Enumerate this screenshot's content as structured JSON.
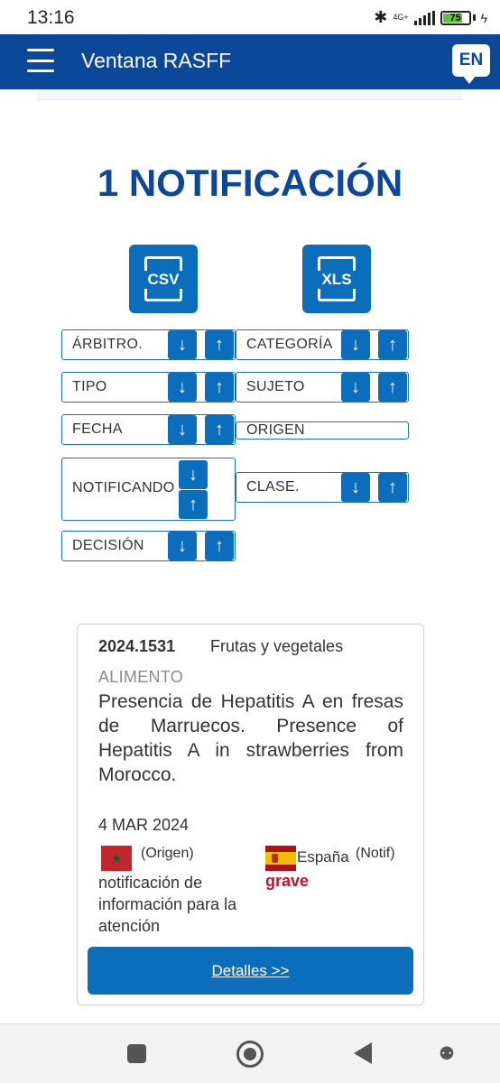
{
  "status_bar": {
    "time": "13:16",
    "network_label": "4G+",
    "battery_level": "75",
    "battery_fraction": 0.75
  },
  "app_bar": {
    "title": "Ventana RASFF",
    "language_button": "EN"
  },
  "results": {
    "count_title": "1 NOTIFICACIÓN"
  },
  "exports": {
    "csv_label": "CSV",
    "xls_label": "XLS"
  },
  "sort_fields": {
    "arbitro": "ÁRBITRO.",
    "categoria": "CATEGORÍA",
    "tipo": "TIPO",
    "sujeto": "SUJETO",
    "fecha": "FECHA",
    "origen": "ORIGEN",
    "notificando": "NOTIFICANDO",
    "clase": "CLASE.",
    "decision": "DECISIÓN"
  },
  "notification": {
    "reference": "2024.1531",
    "category": "Frutas y vegetales",
    "type": "ALIMENTO",
    "subject": "Presencia de Hepatitis A en fresas de Marruecos. Presence of Hepatitis A in strawberries from Morocco.",
    "date": "4 MAR 2024",
    "origin_label": "(Origen)",
    "notifying_country": "España",
    "notifying_label": "(Notif)",
    "risk_decision": "grave",
    "classification": "notificación de información para la atención",
    "details_button": "Detalles >>"
  }
}
